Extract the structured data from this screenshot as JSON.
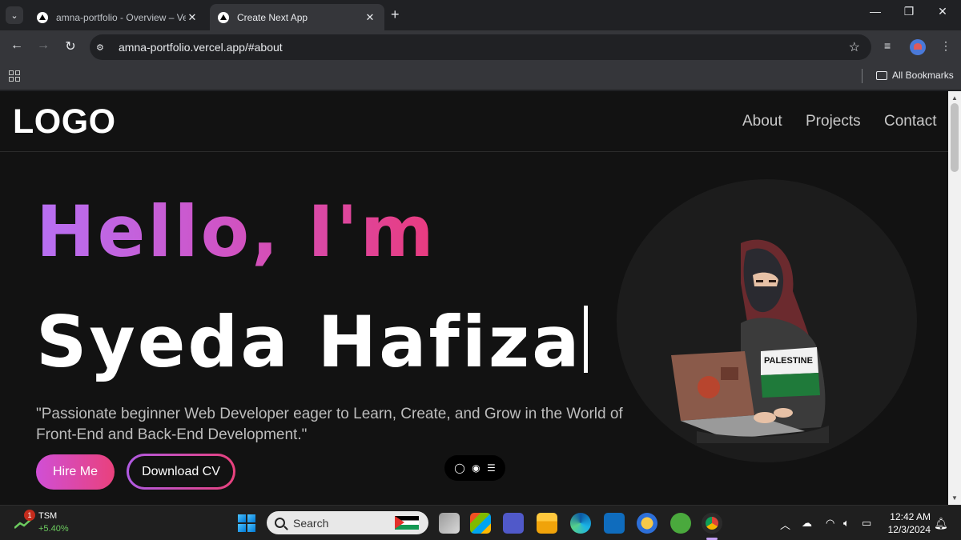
{
  "browser": {
    "tabs": [
      {
        "title": "amna-portfolio - Overview – Ve",
        "close": "✕",
        "active": false
      },
      {
        "title": "Create Next App",
        "close": "✕",
        "active": true
      }
    ],
    "new_tab": "+",
    "window_controls": {
      "minimize": "—",
      "restore": "❐",
      "close": "✕"
    },
    "url": "amna-portfolio.vercel.app/#about",
    "bookmarks_label": "All Bookmarks"
  },
  "site": {
    "logo": "LOGO",
    "nav": [
      "About",
      "Projects",
      "Contact"
    ],
    "hero": {
      "greeting": "Hello, I'm",
      "name": "Syeda Hafiza",
      "tagline": "\"Passionate beginner Web Developer eager to Learn, Create, and Grow in the World of Front-End and Back-End Development.\"",
      "hire_button": "Hire Me",
      "cv_button": "Download CV"
    },
    "avatar_shirt_text": "PALESTINE",
    "colors": {
      "background": "#121212",
      "accent_start": "#b770f3",
      "accent_end": "#e93b7e"
    }
  },
  "taskbar": {
    "stock": {
      "badge": "1",
      "ticker": "TSM",
      "change": "+5.40%"
    },
    "search_placeholder": "Search",
    "clock": {
      "time": "12:42 AM",
      "date": "12/3/2024"
    }
  }
}
